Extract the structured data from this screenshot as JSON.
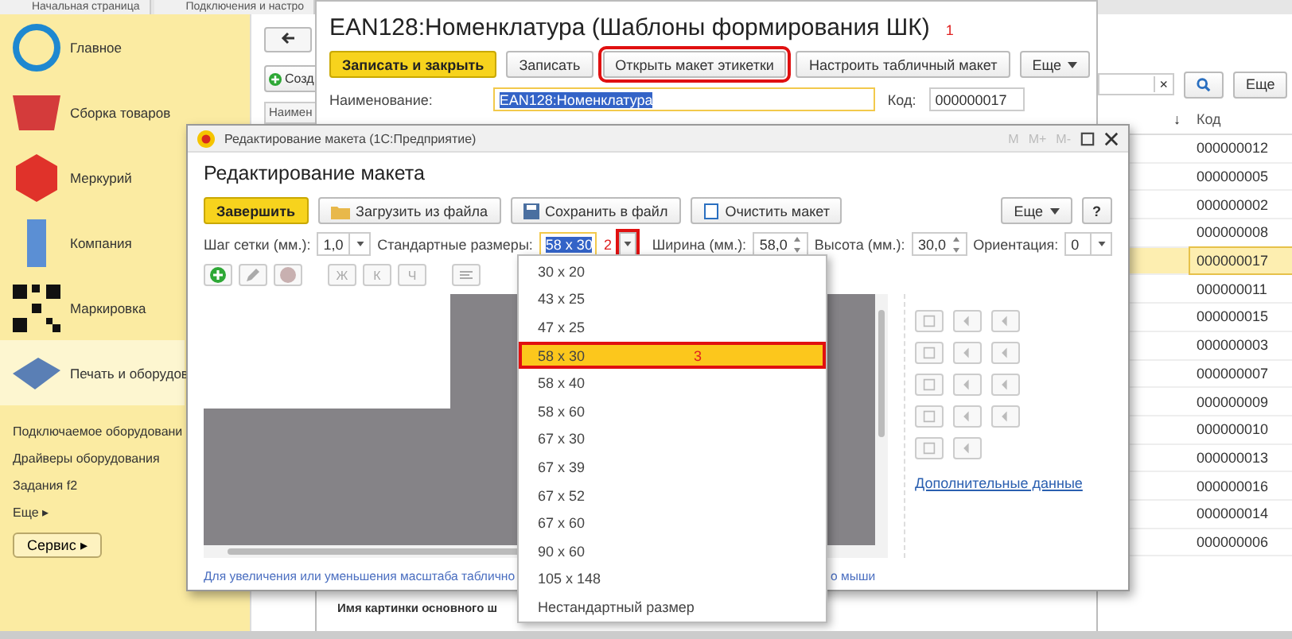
{
  "top_tabs": [
    {
      "label": "Начальная страница",
      "selected": false
    },
    {
      "label": "Подключения и настро",
      "selected": false
    }
  ],
  "sidebar": {
    "sections": [
      {
        "label": "Главное",
        "kind": "globe",
        "selected": false
      },
      {
        "label": "Сборка товаров",
        "kind": "basket",
        "selected": false
      },
      {
        "label": "Меркурий",
        "kind": "cube",
        "selected": false
      },
      {
        "label": "Компания",
        "kind": "building",
        "selected": false
      },
      {
        "label": "Маркировка",
        "kind": "qr",
        "selected": false
      },
      {
        "label": "Печать и оборудов",
        "kind": "terminal",
        "selected": true
      }
    ],
    "links": [
      "Подключаемое оборудовани",
      "Драйверы оборудования",
      "Задания f2"
    ],
    "more": "Еще ▸",
    "service_button": "Сервис ▸"
  },
  "list": {
    "create_button": "Созд",
    "header": "Наимен",
    "search_clear": "×",
    "more_button": "Еще",
    "sort_mark": "↓",
    "code_header": "Код",
    "codes": [
      {
        "value": "000000012",
        "selected": false
      },
      {
        "value": "000000005",
        "selected": false
      },
      {
        "value": "000000002",
        "selected": false
      },
      {
        "value": "000000008",
        "selected": false
      },
      {
        "value": "000000017",
        "selected": true
      },
      {
        "value": "000000011",
        "selected": false
      },
      {
        "value": "000000015",
        "selected": false
      },
      {
        "value": "000000003",
        "selected": false
      },
      {
        "value": "000000007",
        "selected": false
      },
      {
        "value": "000000009",
        "selected": false
      },
      {
        "value": "000000010",
        "selected": false
      },
      {
        "value": "000000013",
        "selected": false
      },
      {
        "value": "000000016",
        "selected": false
      },
      {
        "value": "000000014",
        "selected": false
      },
      {
        "value": "000000006",
        "selected": false
      }
    ]
  },
  "form": {
    "title": "EAN128:Номенклатура (Шаблоны формирования ШК)",
    "marker": "1",
    "buttons": [
      {
        "label": "Записать и закрыть",
        "kind": "primary"
      },
      {
        "label": "Записать",
        "kind": "save"
      },
      {
        "label": "Открыть макет этикетки",
        "kind": "highlighted"
      },
      {
        "label": "Настроить табличный макет",
        "kind": "table"
      },
      {
        "label": "Еще",
        "kind": "menu"
      }
    ],
    "name_label": "Наименование:",
    "name_value": "EAN128:Номенклатура",
    "code_label": "Код:",
    "code_value": "000000017",
    "bottom_label": "Имя картинки основного ш"
  },
  "editor": {
    "window_title": "Редактирование макета (1С:Предприятие)",
    "title_buttons": [
      "M",
      "M+",
      "M-"
    ],
    "heading": "Редактирование макета",
    "toolbar": [
      {
        "label": "Завершить",
        "kind": "primary"
      },
      {
        "label": "Загрузить из файла",
        "kind": "load"
      },
      {
        "label": "Сохранить в файл",
        "kind": "save"
      },
      {
        "label": "Очистить макет",
        "kind": "clear"
      }
    ],
    "more_button": "Еще",
    "help_button": "?",
    "grid_label": "Шаг сетки (мм.):",
    "grid_value": "1,0",
    "sizes_label": "Стандартные размеры:",
    "sizes_value": "58 x 30",
    "marker": "2",
    "width_label": "Ширина (мм.):",
    "width_value": "58,0",
    "height_label": "Высота (мм.):",
    "height_value": "30,0",
    "orientation_label": "Ориентация:",
    "orientation_value": "0",
    "format_buttons": [
      "Ж",
      "К",
      "Ч"
    ],
    "link": "Дополнительные данные",
    "hint_start": "Для увеличения или уменьшения масштаба таблично",
    "hint_end": "о мыши"
  },
  "dropdown": {
    "items": [
      {
        "label": "30 x 20",
        "selected": false
      },
      {
        "label": "43 x 25",
        "selected": false
      },
      {
        "label": "47 x 25",
        "selected": false
      },
      {
        "label": "58 x 30",
        "selected": true,
        "marker": "3"
      },
      {
        "label": "58 x 40",
        "selected": false
      },
      {
        "label": "58 x 60",
        "selected": false
      },
      {
        "label": "67 x 30",
        "selected": false
      },
      {
        "label": "67 x 39",
        "selected": false
      },
      {
        "label": "67 x 52",
        "selected": false
      },
      {
        "label": "67 x 60",
        "selected": false
      },
      {
        "label": "90 x 60",
        "selected": false
      },
      {
        "label": "105 x 148",
        "selected": false
      },
      {
        "label": "Нестандартный размер",
        "selected": false
      }
    ]
  }
}
